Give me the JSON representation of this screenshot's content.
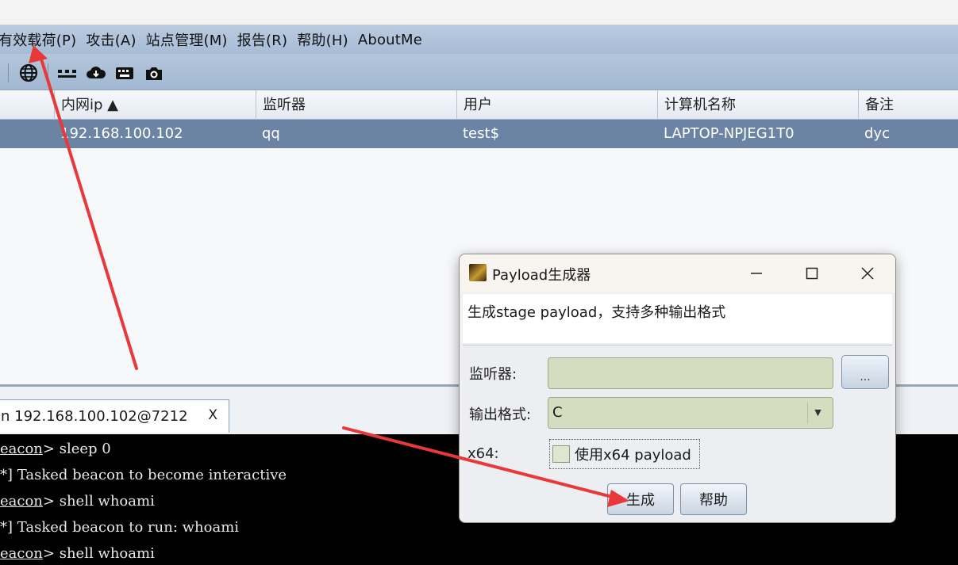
{
  "menu": {
    "items": [
      "有效载荷(P)",
      "攻击(A)",
      "站点管理(M)",
      "报告(R)",
      "帮助(H)",
      "AboutMe"
    ]
  },
  "toolbar": {
    "icons": [
      "globe-icon",
      "connections-icon",
      "cloud-download-icon",
      "keyboard-icon",
      "camera-icon"
    ]
  },
  "table": {
    "columns": [
      "内网ip ▲",
      "监听器",
      "用户",
      "计算机名称",
      "备注"
    ],
    "rows": [
      {
        "ip": "192.168.100.102",
        "listener": "qq",
        "user": "test$",
        "computer": "LAPTOP-NPJEG1T0",
        "note": "dyc"
      }
    ]
  },
  "tab": {
    "label": "n 192.168.100.102@7212",
    "close": "X"
  },
  "console": {
    "lines": [
      {
        "prefix": "eacon",
        "text": "> sleep 0"
      },
      {
        "prefix": "*",
        "text": "] Tasked beacon to become interactive"
      },
      {
        "prefix": "eacon",
        "text": "> shell whoami"
      },
      {
        "prefix": "*",
        "text": "] Tasked beacon to run: whoami"
      },
      {
        "prefix": "eacon",
        "text": "> shell whoami"
      }
    ]
  },
  "dialog": {
    "title": "Payload生成器",
    "description": "生成stage payload，支持多种输出格式",
    "listener_label": "监听器:",
    "listener_value": "",
    "browse_label": "...",
    "format_label": "输出格式:",
    "format_value": "C",
    "x64_label": "x64:",
    "x64_checkbox_label": "使用x64 payload",
    "x64_checked": false,
    "generate_label": "生成",
    "help_label": "帮助"
  },
  "colors": {
    "menubar": "#a7bcd6",
    "selected_row": "#6b84a3",
    "field": "#d6dcc0",
    "annotation_arrow": "#e8383a"
  }
}
